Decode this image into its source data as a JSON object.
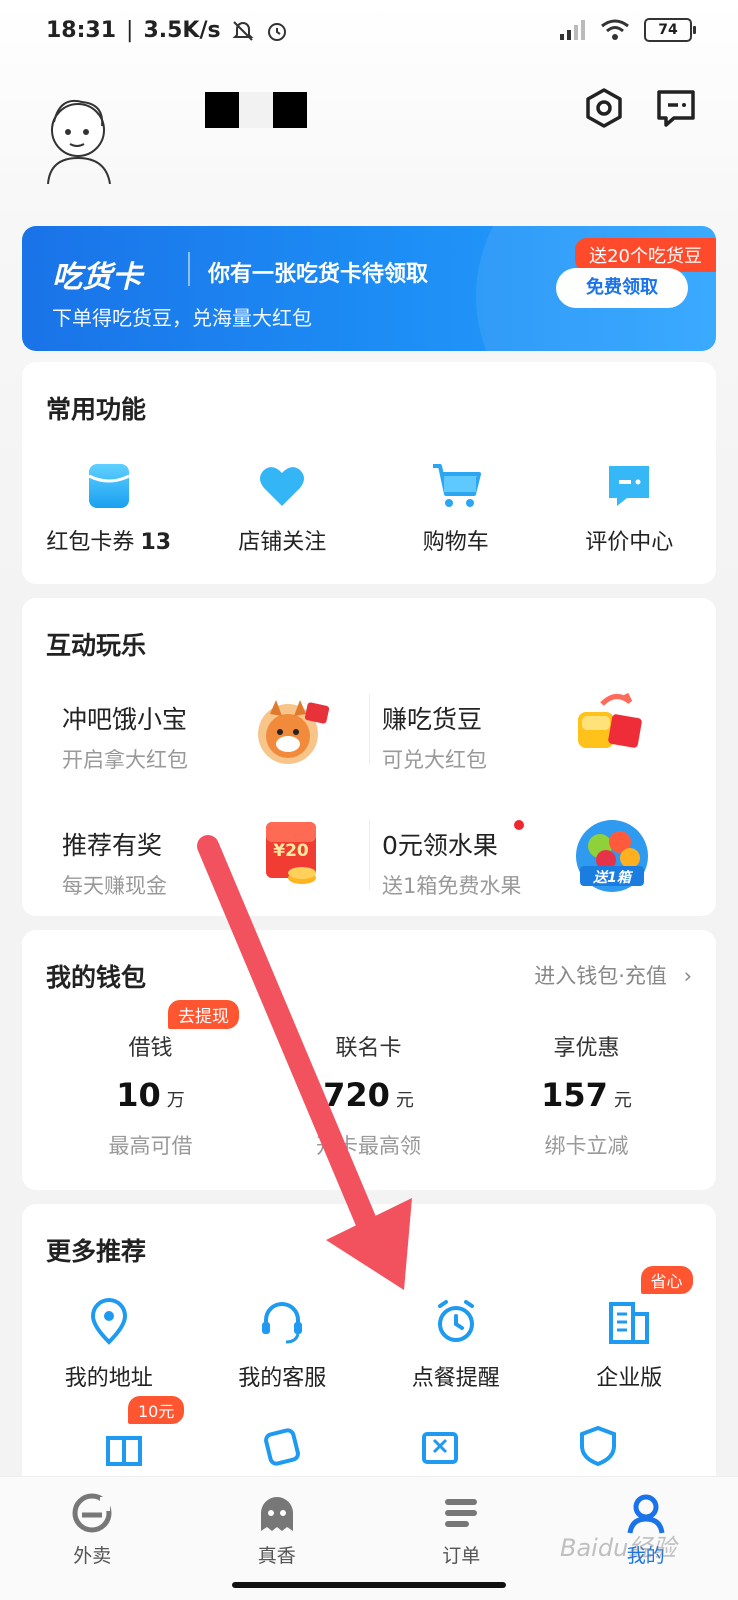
{
  "status_bar": {
    "time": "18:31",
    "speed": "3.5K/s",
    "battery": "74"
  },
  "promo": {
    "brand": "吃货卡",
    "headline": "你有一张吃货卡待领取",
    "subtitle": "下单得吃货豆，兑海量大红包",
    "tag": "送20个吃货豆",
    "button": "免费领取"
  },
  "common": {
    "title": "常用功能",
    "items": [
      {
        "label": "红包卡券",
        "count": "13",
        "icon": "coupon-icon"
      },
      {
        "label": "店铺关注",
        "icon": "heart-icon"
      },
      {
        "label": "购物车",
        "icon": "cart-icon"
      },
      {
        "label": "评价中心",
        "icon": "comment-icon"
      }
    ]
  },
  "play": {
    "title": "互动玩乐",
    "items": [
      {
        "title": "冲吧饿小宝",
        "sub": "开启拿大红包"
      },
      {
        "title": "赚吃货豆",
        "sub": "可兑大红包"
      },
      {
        "title": "推荐有奖",
        "sub": "每天赚现金",
        "img_text": "¥20"
      },
      {
        "title": "0元领水果",
        "sub": "送1箱免费水果",
        "img_text": "送1箱"
      }
    ]
  },
  "wallet": {
    "title": "我的钱包",
    "link": "进入钱包·充值",
    "badge": "去提现",
    "cols": [
      {
        "label": "借钱",
        "value": "10",
        "unit": "万",
        "note": "最高可借"
      },
      {
        "label": "联名卡",
        "value": "720",
        "unit": "元",
        "note": "开卡最高领"
      },
      {
        "label": "享优惠",
        "value": "157",
        "unit": "元",
        "note": "绑卡立减"
      }
    ]
  },
  "more": {
    "title": "更多推荐",
    "items": [
      {
        "label": "我的地址",
        "icon": "location-icon"
      },
      {
        "label": "我的客服",
        "icon": "headset-icon"
      },
      {
        "label": "点餐提醒",
        "icon": "alarm-icon"
      },
      {
        "label": "企业版",
        "icon": "building-icon",
        "badge": "省心"
      }
    ],
    "row2_badge": "10元"
  },
  "nav": [
    {
      "label": "外卖",
      "icon": "takeout-icon"
    },
    {
      "label": "真香",
      "icon": "ghost-icon"
    },
    {
      "label": "订单",
      "icon": "order-icon"
    },
    {
      "label": "我的",
      "icon": "profile-icon"
    }
  ],
  "watermark": "Baidu经验",
  "colors": {
    "accent": "#1a73e8",
    "badge_red": "#ff5530",
    "arrow": "#f2525e"
  }
}
